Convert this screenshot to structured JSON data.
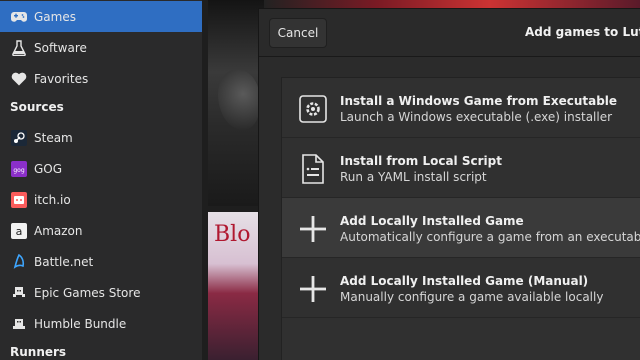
{
  "sidebar": {
    "items": [
      {
        "label": "Games",
        "icon": "gamepad-icon",
        "active": true
      },
      {
        "label": "Software",
        "icon": "flask-icon"
      },
      {
        "label": "Favorites",
        "icon": "heart-icon"
      }
    ],
    "sources_heading": "Sources",
    "sources": [
      {
        "label": "Steam",
        "icon": "steam-icon"
      },
      {
        "label": "GOG",
        "icon": "gog-icon"
      },
      {
        "label": "itch.io",
        "icon": "itchio-icon"
      },
      {
        "label": "Amazon",
        "icon": "amazon-icon"
      },
      {
        "label": "Battle.net",
        "icon": "battlenet-icon"
      },
      {
        "label": "Epic Games Store",
        "icon": "epic-icon"
      },
      {
        "label": "Humble Bundle",
        "icon": "humble-icon"
      }
    ],
    "runners_heading": "Runners"
  },
  "background": {
    "cover_logo": "Blo"
  },
  "dialog": {
    "cancel_label": "Cancel",
    "title": "Add games to Lutris",
    "options": [
      {
        "title": "Install a Windows Game from Executable",
        "description": "Launch a Windows executable (.exe) installer",
        "icon": "gear-icon"
      },
      {
        "title": "Install from Local Script",
        "description": "Run a YAML install script",
        "icon": "script-file-icon"
      },
      {
        "title": "Add Locally Installed Game",
        "description": "Automatically configure a game from an executable",
        "icon": "plus-icon"
      },
      {
        "title": "Add Locally Installed Game (Manual)",
        "description": "Manually configure a game available locally",
        "icon": "plus-icon"
      }
    ]
  },
  "colors": {
    "accent": "#2f6ec2",
    "sidebar_bg": "#2a2a2b",
    "dialog_bg": "#2b2b2b"
  }
}
